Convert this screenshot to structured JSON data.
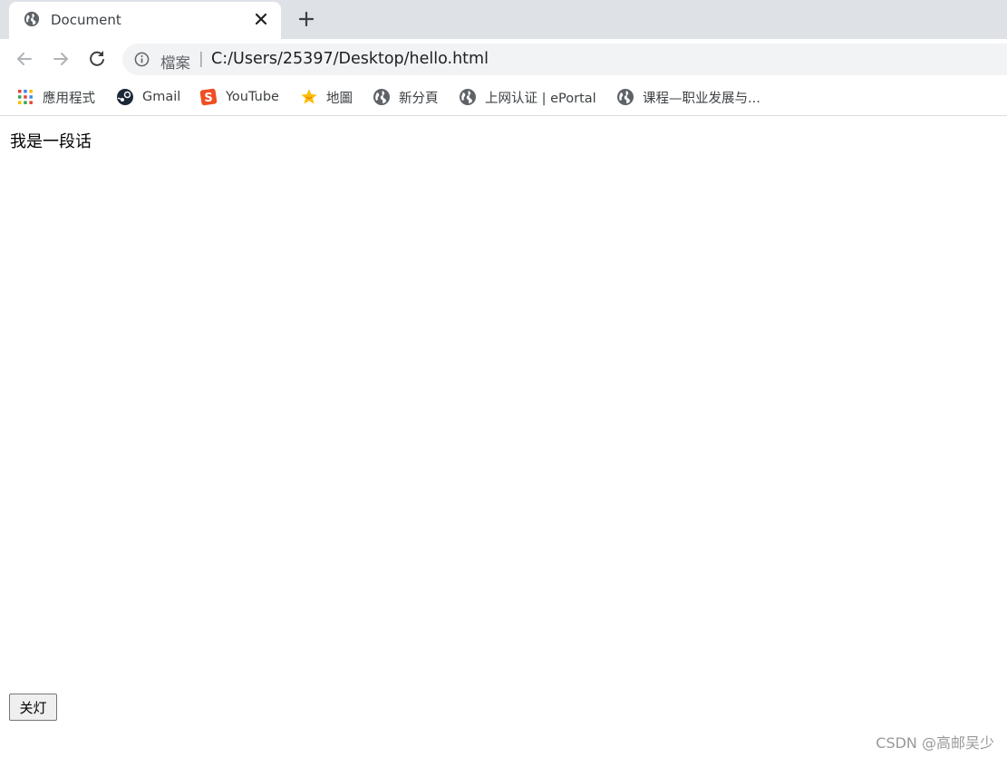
{
  "tab": {
    "title": "Document"
  },
  "address_bar": {
    "scheme_label": "檔案",
    "separator": "|",
    "url": "C:/Users/25397/Desktop/hello.html"
  },
  "bookmarks": [
    {
      "label": "應用程式",
      "icon": "apps-grid-icon"
    },
    {
      "label": "Gmail",
      "icon": "steam-icon"
    },
    {
      "label": "YouTube",
      "icon": "sohu-icon"
    },
    {
      "label": "地圖",
      "icon": "star-icon"
    },
    {
      "label": "新分頁",
      "icon": "globe-icon"
    },
    {
      "label": "上网认证 | ePortal",
      "icon": "globe-icon"
    },
    {
      "label": "课程—职业发展与...",
      "icon": "globe-icon"
    }
  ],
  "page": {
    "paragraph": "我是一段话",
    "button_label": "关灯"
  },
  "watermark": "CSDN @高邮吴少",
  "colors": {
    "tabstrip": "#dee1e6",
    "omnibox": "#f1f3f4",
    "text": "#3c4043",
    "apps_blue": "#4285f4",
    "apps_red": "#ea4335",
    "apps_yellow": "#fbbc04",
    "apps_green": "#34a853"
  }
}
